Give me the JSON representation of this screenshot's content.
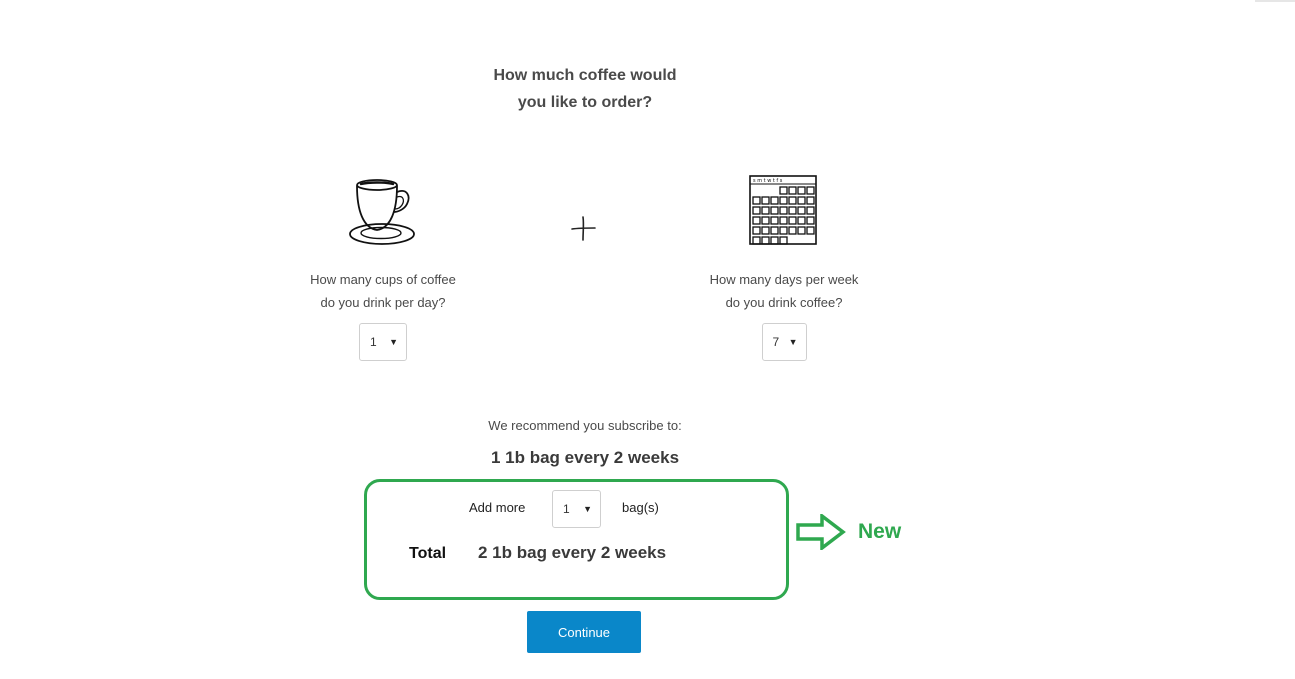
{
  "heading": {
    "line1": "How much coffee would",
    "line2": "you like to order?"
  },
  "cups": {
    "icon": "coffee-cup-icon",
    "question_line1": "How many cups of coffee",
    "question_line2": "do you drink per day?",
    "selected": "1"
  },
  "plus_icon": "plus-icon",
  "days": {
    "icon": "calendar-icon",
    "question_line1": "How many days per week",
    "question_line2": "do you drink coffee?",
    "selected": "7"
  },
  "recommendation": {
    "label": "We recommend you subscribe to:",
    "plan": "1 1b bag every 2 weeks"
  },
  "add_more": {
    "label": "Add more",
    "selected": "1",
    "unit": "bag(s)"
  },
  "total": {
    "label": "Total",
    "value": "2 1b bag every 2 weeks"
  },
  "annotation": {
    "label": "New",
    "color": "#2fa84f",
    "icon": "arrow-right-icon"
  },
  "continue_button": {
    "label": "Continue",
    "color": "#0a87c9"
  },
  "select_caret": "▼"
}
